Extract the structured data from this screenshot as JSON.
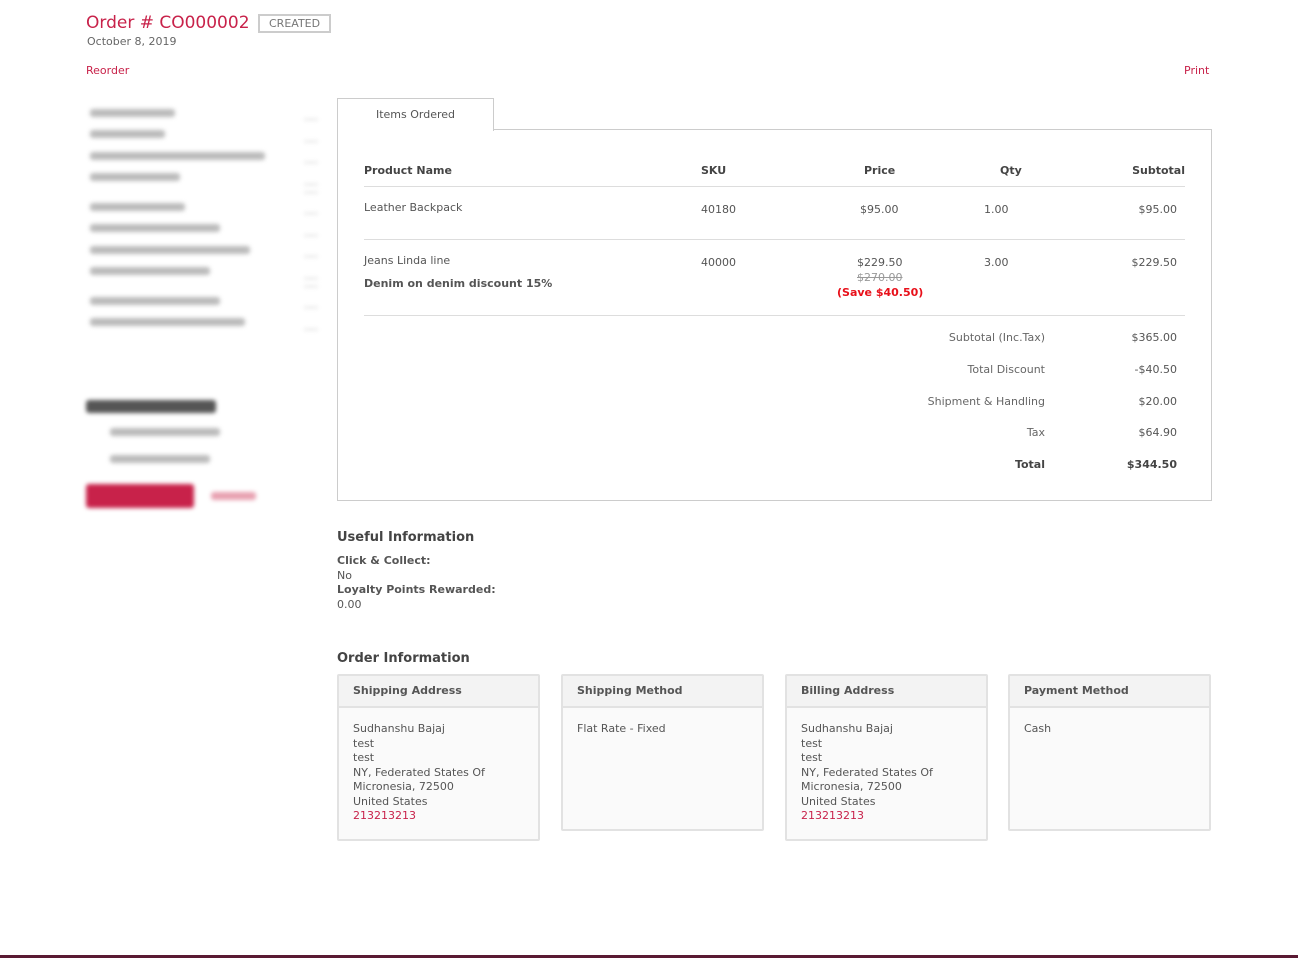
{
  "header": {
    "title": "Order # CO000002",
    "status": "CREATED",
    "date": "October 8, 2019",
    "reorder": "Reorder",
    "print": "Print"
  },
  "tabs": [
    {
      "label": "Items Ordered"
    }
  ],
  "table": {
    "columns": [
      "Product Name",
      "SKU",
      "Price",
      "Qty",
      "Subtotal"
    ],
    "rows": [
      {
        "name": "Leather Backpack",
        "sku": "40180",
        "price": "$95.00",
        "qty": "1.00",
        "subtotal": "$95.00"
      },
      {
        "name": "Jeans Linda line",
        "discount": "Denim on denim discount 15%",
        "sku": "40000",
        "price": "$229.50",
        "original_price": "$270.00",
        "save": "(Save $40.50)",
        "qty": "3.00",
        "subtotal": "$229.50"
      }
    ]
  },
  "totals": [
    {
      "label": "Subtotal (Inc.Tax)",
      "value": "$365.00"
    },
    {
      "label": "Total Discount",
      "value": "-$40.50"
    },
    {
      "label": "Shipment & Handling",
      "value": "$20.00"
    },
    {
      "label": "Tax",
      "value": "$64.90"
    },
    {
      "label": "Total",
      "value": "$344.50"
    }
  ],
  "useful": {
    "title": "Useful Information",
    "click_label": "Click & Collect:",
    "click_value": "No",
    "loyalty_label": "Loyalty Points Rewarded:",
    "loyalty_value": "0.00"
  },
  "order_info": {
    "title": "Order Information",
    "shipping_address": {
      "title": "Shipping Address",
      "lines": [
        "Sudhanshu Bajaj",
        "test",
        "test",
        "NY, Federated States Of",
        "Micronesia, 72500",
        "United States"
      ],
      "phone": "213213213"
    },
    "shipping_method": {
      "title": "Shipping Method",
      "value": "Flat Rate - Fixed"
    },
    "billing_address": {
      "title": "Billing Address",
      "lines": [
        "Sudhanshu Bajaj",
        "test",
        "test",
        "NY, Federated States Of",
        "Micronesia, 72500",
        "United States"
      ],
      "phone": "213213213"
    },
    "payment_method": {
      "title": "Payment Method",
      "value": "Cash"
    }
  },
  "colors": {
    "accent": "#c8224a",
    "save": "#e8101a"
  }
}
